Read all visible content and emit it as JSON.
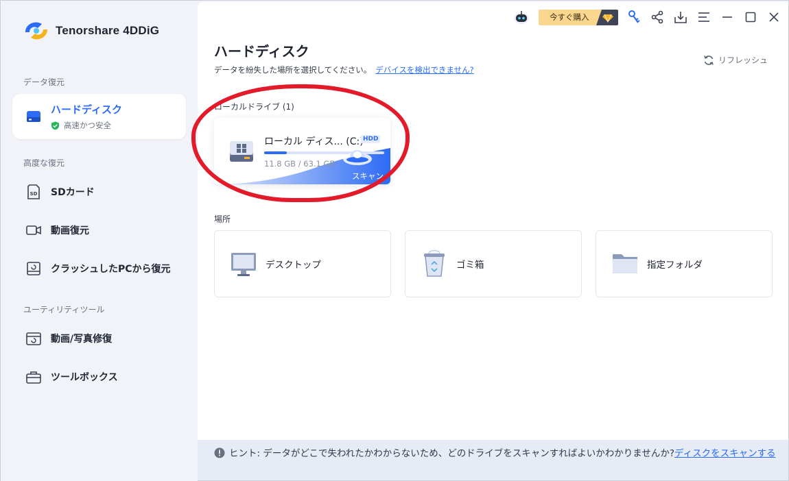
{
  "app": {
    "name": "Tenorshare 4DDiG"
  },
  "topbar": {
    "buy_label": "今すぐ購入"
  },
  "sidebar": {
    "section_recovery": "データ復元",
    "section_advanced": "高度な復元",
    "section_utility": "ユーティリティツール",
    "items": [
      {
        "label": "ハードディスク",
        "sub": "高速かつ安全"
      },
      {
        "label": "SDカード"
      },
      {
        "label": "動画復元"
      },
      {
        "label": "クラッシュしたPCから復元"
      },
      {
        "label": "動画/写真修復"
      },
      {
        "label": "ツールボックス"
      }
    ]
  },
  "main": {
    "title": "ハードディスク",
    "subtitle": "データを紛失した場所を選択してください。",
    "detect_link": "デバイスを検出できません?",
    "refresh_label": "リフレッシュ",
    "local_drives_label": "ローカルドライブ (1)",
    "drive": {
      "name": "ローカル ディス... (C:)",
      "badge": "HDD",
      "size": "11.8 GB / 63.1 GB",
      "used_fraction": 0.187,
      "scan_label": "スキャン"
    },
    "locations_label": "場所",
    "locations": [
      {
        "label": "デスクトップ"
      },
      {
        "label": "ゴミ箱"
      },
      {
        "label": "指定フォルダ"
      }
    ]
  },
  "hint": {
    "prefix": "ヒント:",
    "text": "データがどこで失われたかわからないため、どのドライブをスキャンすればよいかわかりませんか?",
    "link": "ディスクをスキャンする"
  },
  "colors": {
    "accent": "#2c6bf5",
    "highlight": "#e21a2a",
    "buy": "#fbd68e"
  },
  "icons": [
    "robot-icon",
    "diamond-icon",
    "key-icon",
    "share-icon",
    "download-icon",
    "menu-icon",
    "minimize-icon",
    "maximize-icon",
    "close-icon",
    "refresh-icon",
    "hard-drive-icon",
    "sd-card-icon",
    "video-icon",
    "crashed-pc-icon",
    "photo-repair-icon",
    "toolbox-icon",
    "monitor-icon",
    "trash-icon",
    "folder-icon",
    "info-icon",
    "shield-check-icon"
  ]
}
